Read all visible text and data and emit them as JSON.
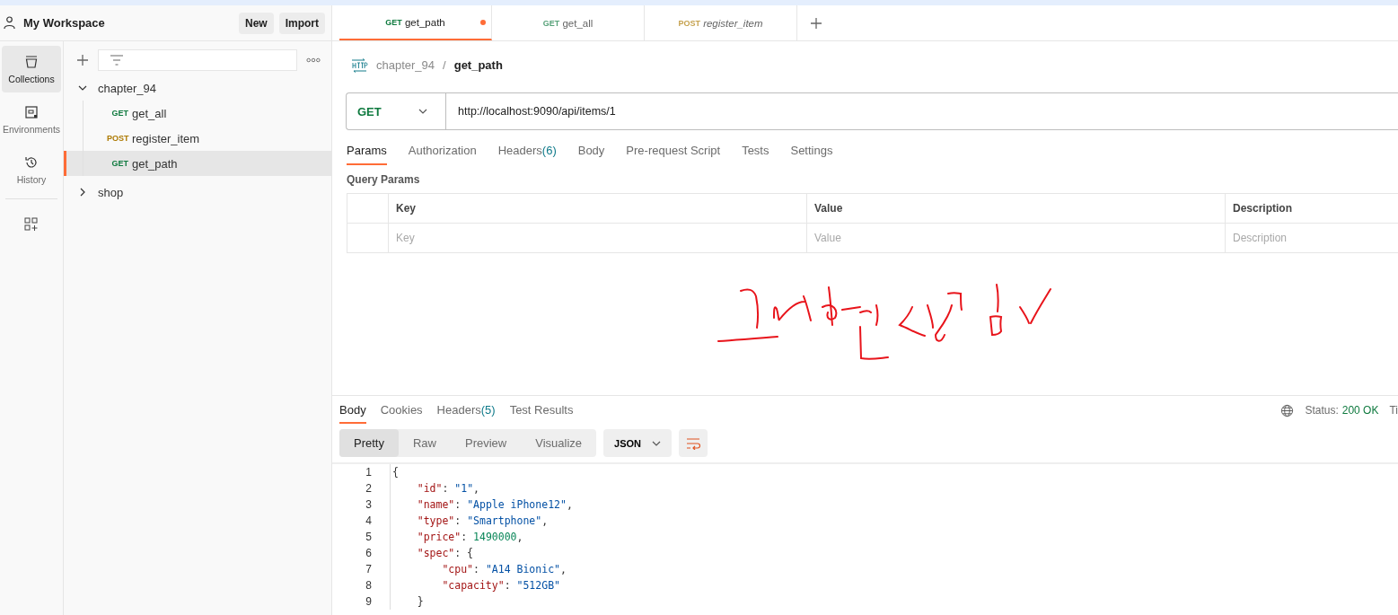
{
  "workspace": {
    "title": "My Workspace",
    "buttons": [
      "New",
      "Import"
    ]
  },
  "rail": [
    {
      "label": "Collections",
      "selected": true
    },
    {
      "label": "Environments",
      "selected": false
    },
    {
      "label": "History",
      "selected": false
    }
  ],
  "tree": [
    {
      "name": "chapter_94",
      "expanded": true,
      "children": [
        {
          "method": "GET",
          "name": "get_all",
          "selected": false
        },
        {
          "method": "POST",
          "name": "register_item",
          "selected": false
        },
        {
          "method": "GET",
          "name": "get_path",
          "selected": true
        }
      ]
    },
    {
      "name": "shop",
      "expanded": false
    }
  ],
  "request_tabs": [
    {
      "method": "GET",
      "name": "get_path",
      "selected": true,
      "unsaved": true
    },
    {
      "method": "GET",
      "name": "get_all",
      "selected": false,
      "unsaved": false
    },
    {
      "method": "POST",
      "name": "register_item",
      "selected": false,
      "unsaved": false
    }
  ],
  "breadcrumb": {
    "collection": "chapter_94",
    "separator": "/",
    "request": "get_path"
  },
  "request": {
    "method": "GET",
    "url": "http://localhost:9090/api/items/1"
  },
  "option_tabs": [
    {
      "label": "Params",
      "selected": true
    },
    {
      "label": "Authorization",
      "selected": false
    },
    {
      "label": "Headers",
      "count": "(6)",
      "selected": false
    },
    {
      "label": "Body",
      "selected": false
    },
    {
      "label": "Pre-request Script",
      "selected": false
    },
    {
      "label": "Tests",
      "selected": false
    },
    {
      "label": "Settings",
      "selected": false
    }
  ],
  "query_params": {
    "title": "Query Params",
    "columns": [
      "Key",
      "Value",
      "Description"
    ],
    "placeholders": [
      "Key",
      "Value",
      "Description"
    ]
  },
  "response": {
    "tabs": [
      {
        "label": "Body",
        "selected": true
      },
      {
        "label": "Cookies",
        "selected": false
      },
      {
        "label": "Headers",
        "count": "(5)",
        "selected": false
      },
      {
        "label": "Test Results",
        "selected": false
      }
    ],
    "status_label": "Status:",
    "status": "200 OK",
    "cut_text": "Ti",
    "views": [
      {
        "label": "Pretty",
        "selected": true
      },
      {
        "label": "Raw",
        "selected": false
      },
      {
        "label": "Preview",
        "selected": false
      },
      {
        "label": "Visualize",
        "selected": false
      }
    ],
    "format": "JSON",
    "lines": [
      {
        "number": "1",
        "text": "{"
      },
      {
        "number": "2",
        "text": "    \"id\": \"1\","
      },
      {
        "number": "3",
        "text": "    \"name\": \"Apple iPhone12\","
      },
      {
        "number": "4",
        "text": "    \"type\": \"Smartphone\","
      },
      {
        "number": "5",
        "text": "    \"price\": 1490000,"
      },
      {
        "number": "6",
        "text": "    \"spec\": {"
      },
      {
        "number": "7",
        "text": "        \"cpu\": \"A14 Bionic\","
      },
      {
        "number": "8",
        "text": "        \"capacity\": \"512GB\""
      },
      {
        "number": "9",
        "text": "    }"
      }
    ]
  }
}
